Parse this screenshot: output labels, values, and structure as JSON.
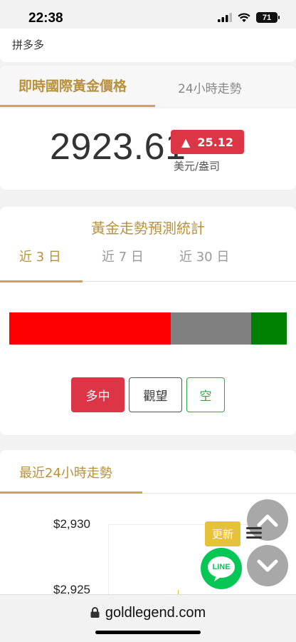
{
  "status": {
    "time": "22:38",
    "battery": "71"
  },
  "top": {
    "text": "拼多多"
  },
  "price_tabs": {
    "live": "即時國際黃金價格",
    "trend24": "24小時走勢"
  },
  "price": {
    "value": "2923.61",
    "change_arrow": "▲",
    "change": "25.12",
    "unit": "美元/盎司"
  },
  "forecast": {
    "title": "黃金走勢預測統計",
    "tabs": [
      "近 3 日",
      "近 7 日",
      "近 30 日"
    ],
    "bars": {
      "long": 0.545,
      "watch": 0.27,
      "short": 0.12
    },
    "buttons": {
      "long": "多中",
      "watch": "觀望",
      "short": "空"
    }
  },
  "trend": {
    "title": "最近24小時走勢",
    "ticks": [
      "$2,930",
      "$2,925"
    ]
  },
  "float": {
    "update": "更新",
    "line": "LINE"
  },
  "url": {
    "domain": "goldlegend.com"
  },
  "colors": {
    "gold": "#b8913c",
    "red": "#dc3545",
    "green": "#28a745",
    "line_green": "#06c755"
  }
}
